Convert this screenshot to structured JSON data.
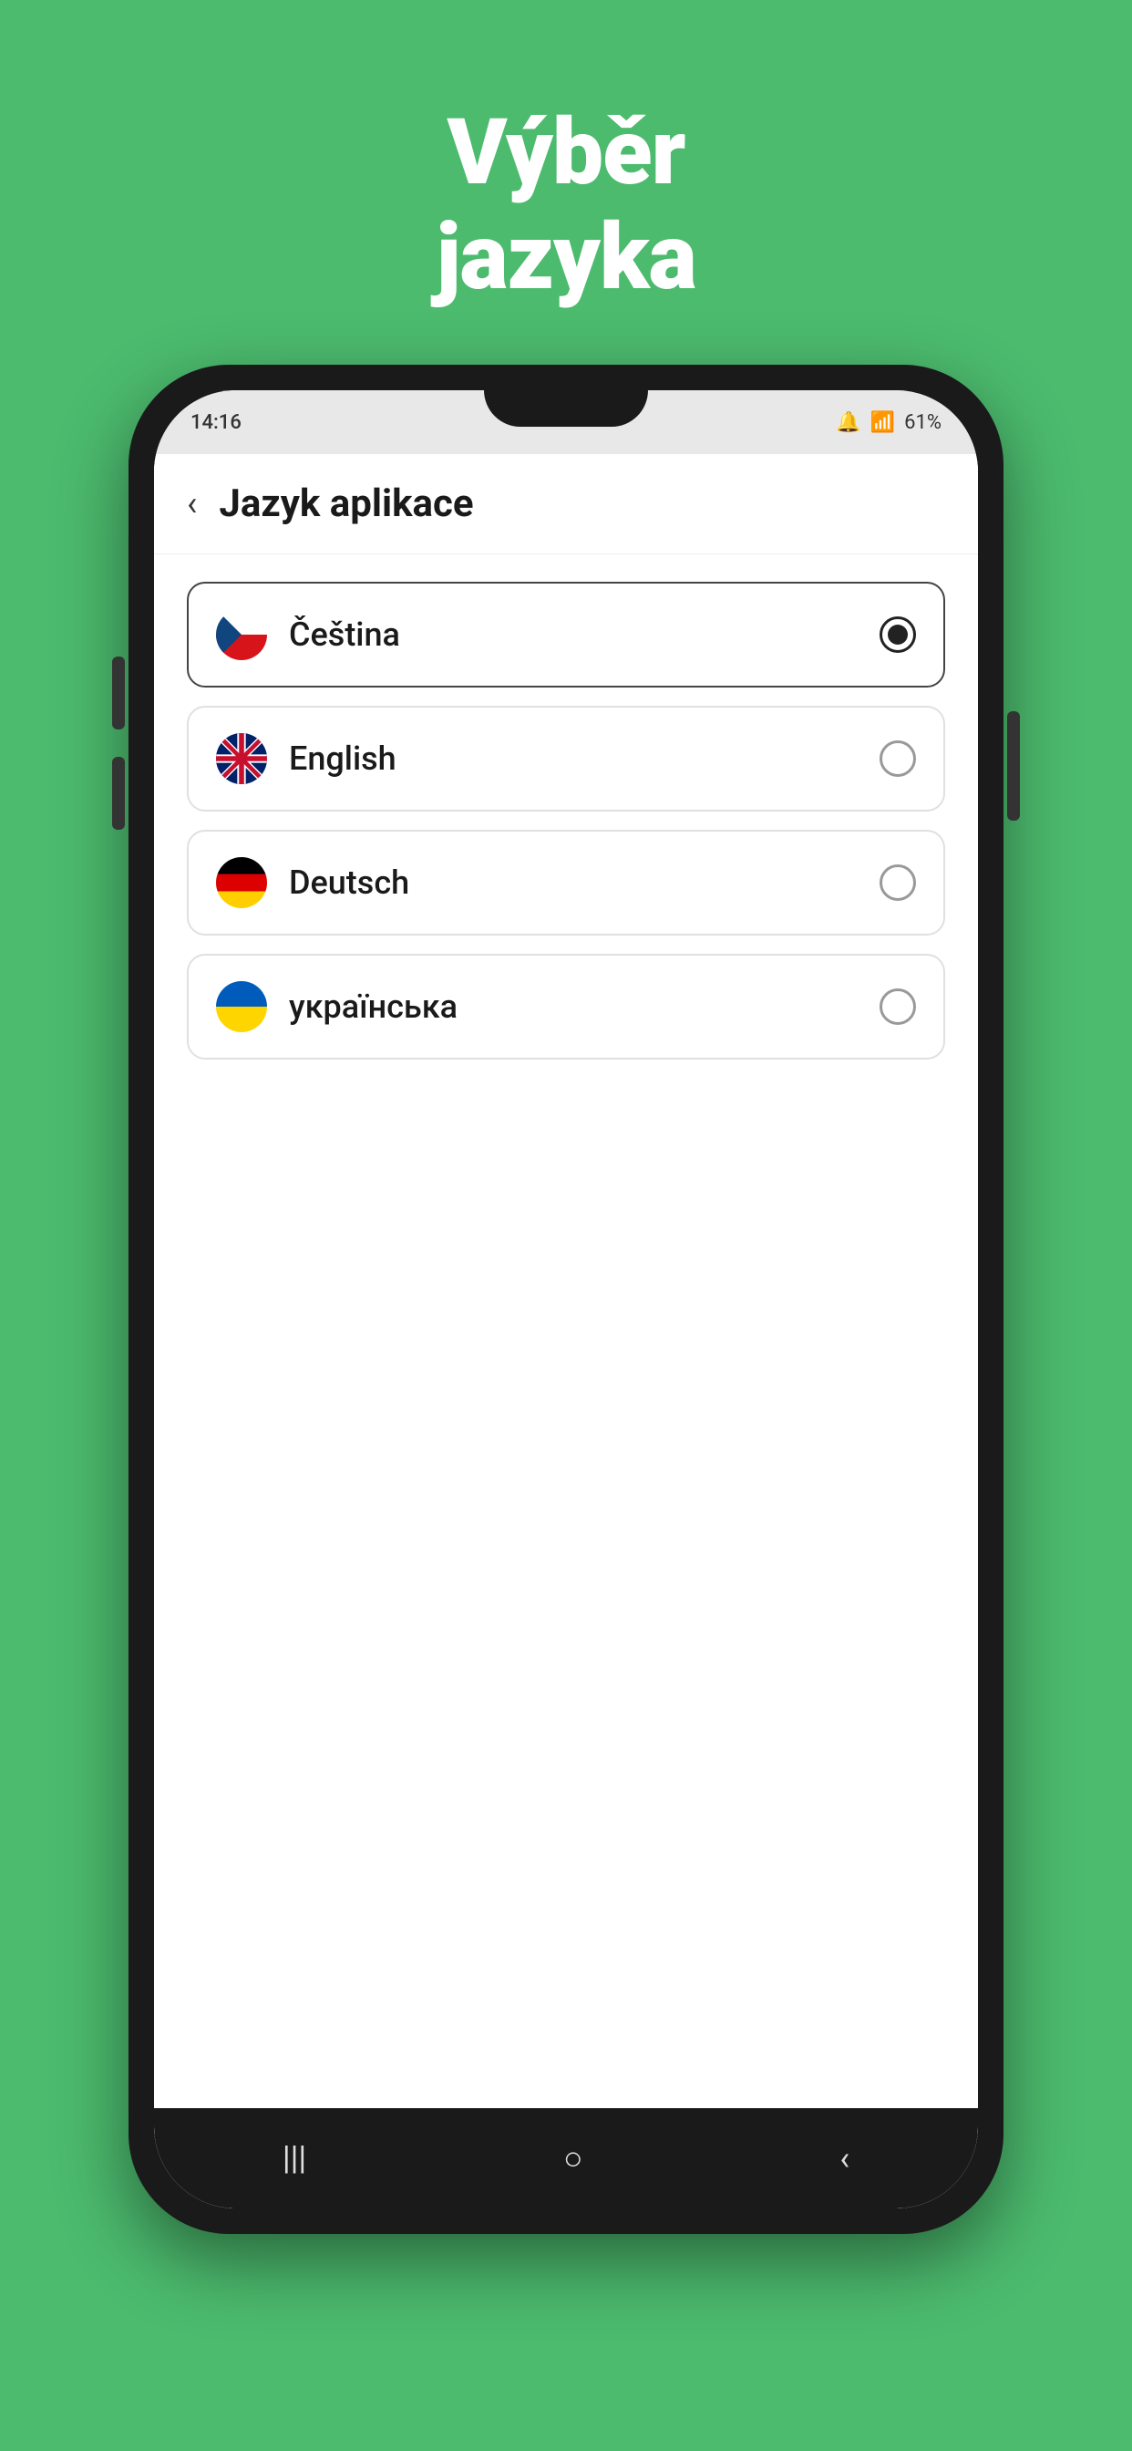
{
  "background": {
    "color": "#4cbb6e"
  },
  "page_title": {
    "line1": "Výběr",
    "line2": "jazyka"
  },
  "status_bar": {
    "time": "14:16",
    "battery": "61%"
  },
  "app_bar": {
    "title": "Jazyk aplikace",
    "back_label": "‹"
  },
  "languages": [
    {
      "id": "cs",
      "name": "Čeština",
      "flag": "cz",
      "selected": true
    },
    {
      "id": "en",
      "name": "English",
      "flag": "gb",
      "selected": false
    },
    {
      "id": "de",
      "name": "Deutsch",
      "flag": "de",
      "selected": false
    },
    {
      "id": "uk",
      "name": "українська",
      "flag": "ua",
      "selected": false
    }
  ],
  "nav_bar": {
    "recent_icon": "|||",
    "home_icon": "○",
    "back_icon": "‹"
  }
}
